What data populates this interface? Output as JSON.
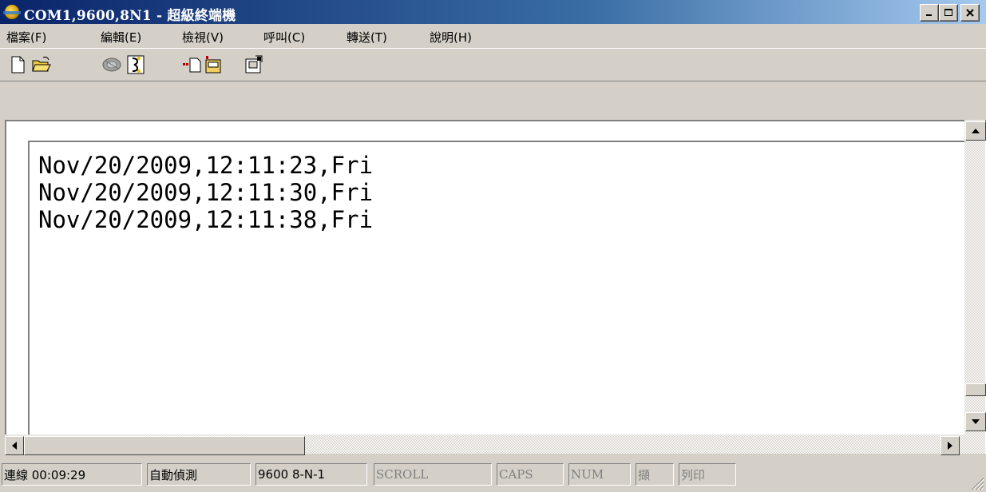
{
  "window": {
    "title": "COM1,9600,8N1 - 超級終端機",
    "controls": {
      "minimize": "_",
      "maximize": "□",
      "close": "×"
    }
  },
  "menu": {
    "items": [
      {
        "label": "檔案(F)"
      },
      {
        "label": "編輯(E)"
      },
      {
        "label": "檢視(V)"
      },
      {
        "label": "呼叫(C)"
      },
      {
        "label": "轉送(T)"
      },
      {
        "label": "說明(H)"
      }
    ]
  },
  "toolbar": {
    "buttons": [
      {
        "name": "new-document-icon"
      },
      {
        "name": "open-folder-icon"
      },
      {
        "name": "phone-dial-icon"
      },
      {
        "name": "disconnect-icon"
      },
      {
        "name": "send-file-icon"
      },
      {
        "name": "receive-file-icon"
      },
      {
        "name": "properties-icon"
      }
    ]
  },
  "terminal": {
    "lines": [
      "Nov/20/2009,12:11:23,Fri",
      "Nov/20/2009,12:11:30,Fri",
      "Nov/20/2009,12:11:38,Fri"
    ]
  },
  "statusbar": {
    "connection": "連線 00:09:29",
    "detect": "自動偵測",
    "settings": "9600 8-N-1",
    "scroll": "SCROLL",
    "caps": "CAPS",
    "num": "NUM",
    "capture": "擷",
    "print": "列印"
  }
}
